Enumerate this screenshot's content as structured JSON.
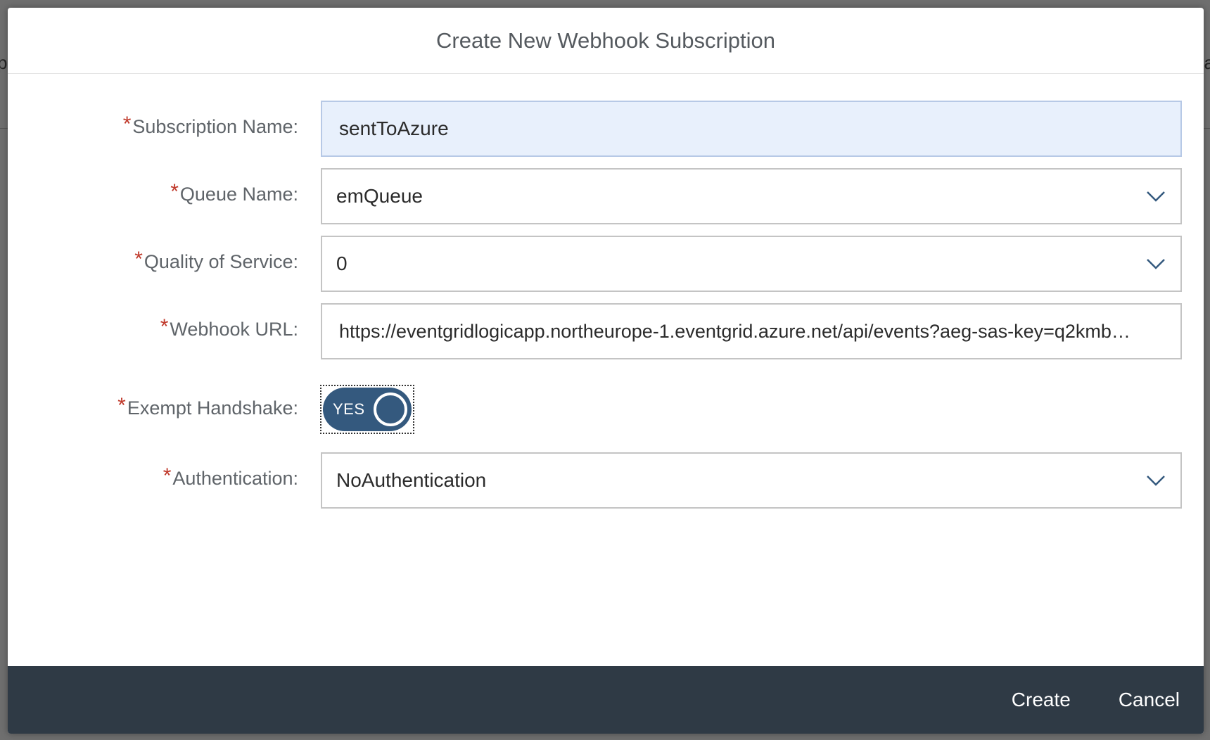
{
  "background": {
    "left_fragment": "p",
    "right_fragment": "a"
  },
  "dialog": {
    "title": "Create New Webhook Subscription",
    "fields": {
      "subscription_name": {
        "label": "Subscription Name:",
        "value": "sentToAzure"
      },
      "queue_name": {
        "label": "Queue Name:",
        "value": "emQueue"
      },
      "quality_of_service": {
        "label": "Quality of Service:",
        "value": "0"
      },
      "webhook_url": {
        "label": "Webhook URL:",
        "value": "https://eventgridlogicapp.northeurope-1.eventgrid.azure.net/api/events?aeg-sas-key=q2kmb…"
      },
      "exempt_handshake": {
        "label": "Exempt Handshake:",
        "toggle_text": "YES"
      },
      "authentication": {
        "label": "Authentication:",
        "value": "NoAuthentication"
      }
    },
    "required_marker": "*",
    "footer": {
      "create_label": "Create",
      "cancel_label": "Cancel"
    }
  },
  "colors": {
    "accent": "#34597e",
    "footer_bg": "#2f3a45",
    "required": "#c0392b",
    "active_field_bg": "#e8f0fc"
  },
  "icons": {
    "dropdown": "chevron-down-icon",
    "toggle_knob": "toggle-knob-icon"
  }
}
